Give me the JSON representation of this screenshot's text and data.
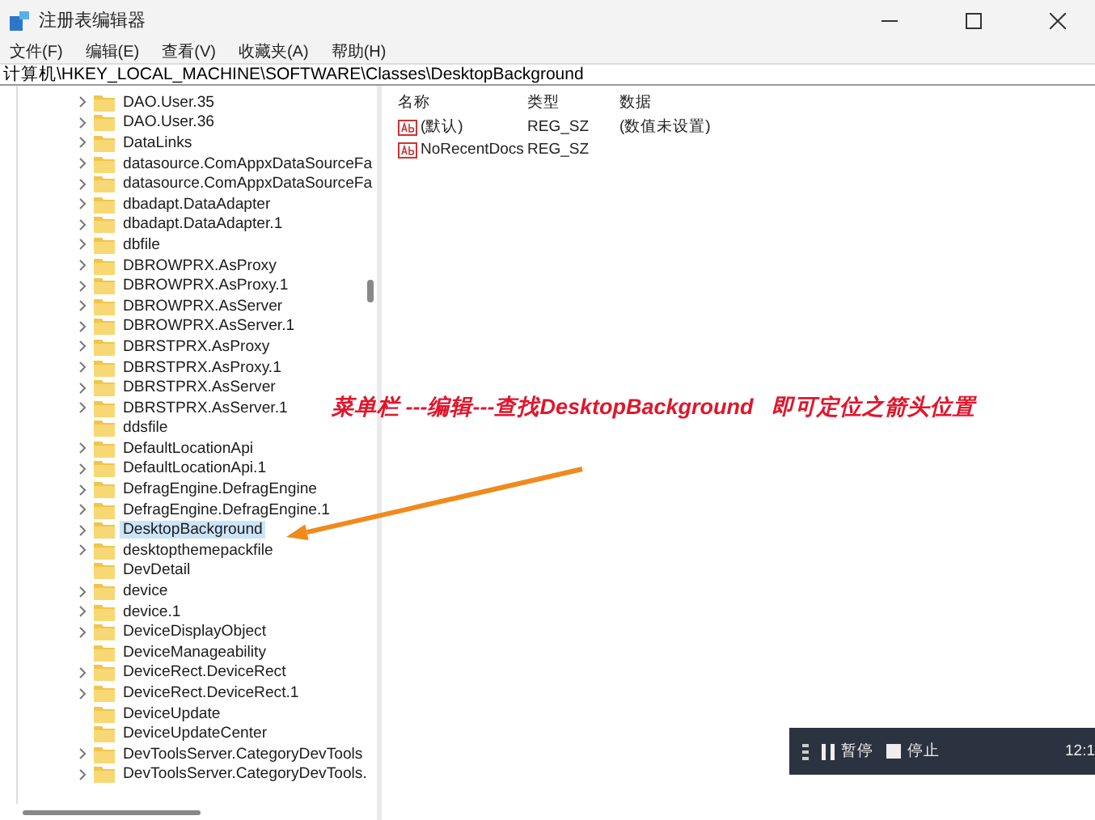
{
  "window": {
    "title": "注册表编辑器"
  },
  "menu": [
    "文件(F)",
    "编辑(E)",
    "查看(V)",
    "收藏夹(A)",
    "帮助(H)"
  ],
  "address": "计算机\\HKEY_LOCAL_MACHINE\\SOFTWARE\\Classes\\DesktopBackground",
  "tree": [
    {
      "label": "DAO.User.35",
      "expandable": true,
      "selected": false
    },
    {
      "label": "DAO.User.36",
      "expandable": true,
      "selected": false
    },
    {
      "label": "DataLinks",
      "expandable": true,
      "selected": false
    },
    {
      "label": "datasource.ComAppxDataSourceFa",
      "expandable": true,
      "selected": false
    },
    {
      "label": "datasource.ComAppxDataSourceFa",
      "expandable": true,
      "selected": false
    },
    {
      "label": "dbadapt.DataAdapter",
      "expandable": true,
      "selected": false
    },
    {
      "label": "dbadapt.DataAdapter.1",
      "expandable": true,
      "selected": false
    },
    {
      "label": "dbfile",
      "expandable": true,
      "selected": false
    },
    {
      "label": "DBROWPRX.AsProxy",
      "expandable": true,
      "selected": false
    },
    {
      "label": "DBROWPRX.AsProxy.1",
      "expandable": true,
      "selected": false
    },
    {
      "label": "DBROWPRX.AsServer",
      "expandable": true,
      "selected": false
    },
    {
      "label": "DBROWPRX.AsServer.1",
      "expandable": true,
      "selected": false
    },
    {
      "label": "DBRSTPRX.AsProxy",
      "expandable": true,
      "selected": false
    },
    {
      "label": "DBRSTPRX.AsProxy.1",
      "expandable": true,
      "selected": false
    },
    {
      "label": "DBRSTPRX.AsServer",
      "expandable": true,
      "selected": false
    },
    {
      "label": "DBRSTPRX.AsServer.1",
      "expandable": true,
      "selected": false
    },
    {
      "label": "ddsfile",
      "expandable": false,
      "selected": false
    },
    {
      "label": "DefaultLocationApi",
      "expandable": true,
      "selected": false
    },
    {
      "label": "DefaultLocationApi.1",
      "expandable": true,
      "selected": false
    },
    {
      "label": "DefragEngine.DefragEngine",
      "expandable": true,
      "selected": false
    },
    {
      "label": "DefragEngine.DefragEngine.1",
      "expandable": true,
      "selected": false
    },
    {
      "label": "DesktopBackground",
      "expandable": true,
      "selected": true
    },
    {
      "label": "desktopthemepackfile",
      "expandable": true,
      "selected": false
    },
    {
      "label": "DevDetail",
      "expandable": false,
      "selected": false
    },
    {
      "label": "device",
      "expandable": true,
      "selected": false
    },
    {
      "label": "device.1",
      "expandable": true,
      "selected": false
    },
    {
      "label": "DeviceDisplayObject",
      "expandable": true,
      "selected": false
    },
    {
      "label": "DeviceManageability",
      "expandable": false,
      "selected": false
    },
    {
      "label": "DeviceRect.DeviceRect",
      "expandable": true,
      "selected": false
    },
    {
      "label": "DeviceRect.DeviceRect.1",
      "expandable": true,
      "selected": false
    },
    {
      "label": "DeviceUpdate",
      "expandable": false,
      "selected": false
    },
    {
      "label": "DeviceUpdateCenter",
      "expandable": false,
      "selected": false
    },
    {
      "label": "DevToolsServer.CategoryDevTools",
      "expandable": true,
      "selected": false
    },
    {
      "label": "DevToolsServer.CategoryDevTools.",
      "expandable": true,
      "selected": false
    }
  ],
  "values": {
    "columns": [
      "名称",
      "类型",
      "数据"
    ],
    "rows": [
      {
        "name": "(默认)",
        "type": "REG_SZ",
        "data": "(数值未设置)"
      },
      {
        "name": "NoRecentDocs",
        "type": "REG_SZ",
        "data": ""
      }
    ]
  },
  "annotation": "菜单栏 ---编辑---查找DesktopBackground   即可定位之箭头位置",
  "recorder": {
    "pause": "暂停",
    "stop": "停止",
    "time": "12:1"
  }
}
